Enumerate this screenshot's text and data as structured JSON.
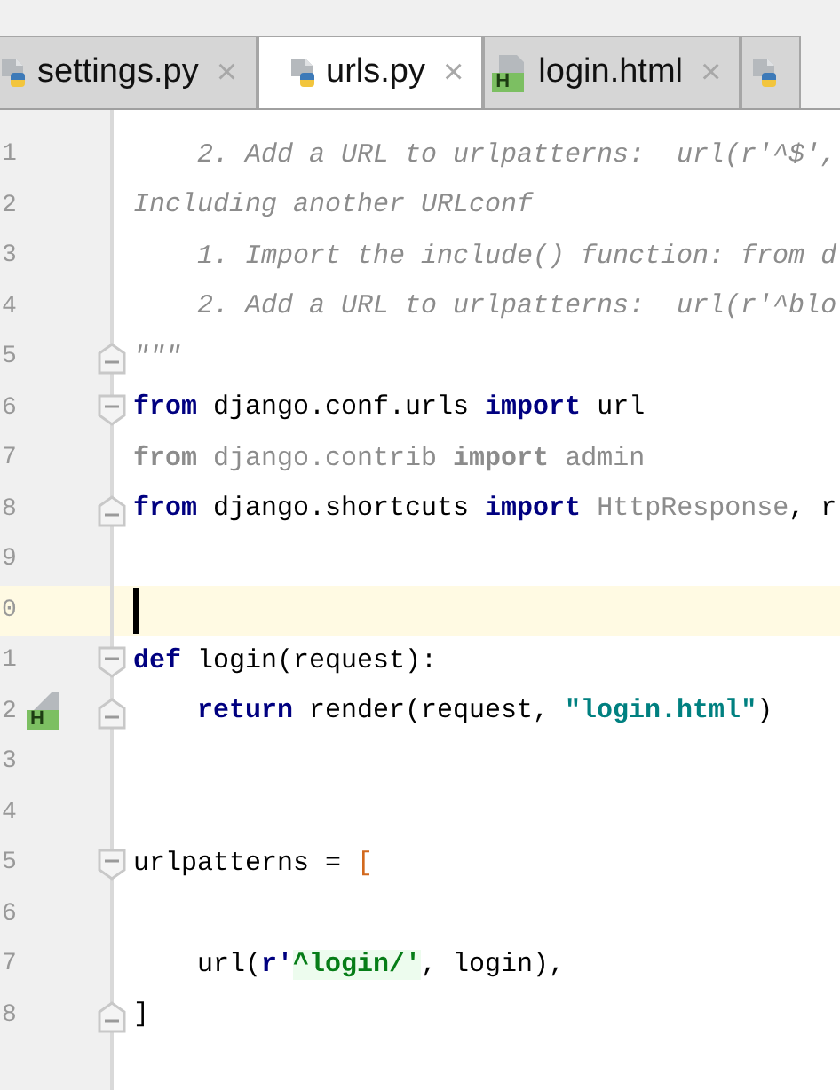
{
  "tabs": [
    {
      "label": "settings.py",
      "kind": "python",
      "close": "×",
      "selected": false
    },
    {
      "label": "urls.py",
      "kind": "python",
      "close": "×",
      "selected": true
    },
    {
      "label": "login.html",
      "kind": "html",
      "badge": "H",
      "close": "×",
      "selected": false
    },
    {
      "kind": "python",
      "selected": false
    }
  ],
  "editor": {
    "lines": [
      {
        "number": "1",
        "tokens": [
          {
            "text": "    2. Add a URL to urlpatterns:  url(r'^$',",
            "kind": "comment"
          }
        ]
      },
      {
        "number": "2",
        "tokens": [
          {
            "text": "Including another URLconf",
            "kind": "comment"
          }
        ]
      },
      {
        "number": "3",
        "tokens": [
          {
            "text": "    1. Import the include() function: from d",
            "kind": "comment"
          }
        ]
      },
      {
        "number": "4",
        "tokens": [
          {
            "text": "    2. Add a URL to urlpatterns:  url(r'^blo",
            "kind": "comment"
          }
        ]
      },
      {
        "number": "5",
        "fold_end": true,
        "tokens": [
          {
            "text": "\"\"\"",
            "kind": "comment"
          }
        ]
      },
      {
        "number": "6",
        "fold_start": true,
        "tokens": [
          {
            "text": "from",
            "kind": "keyword"
          },
          {
            "text": " django.conf.urls ",
            "kind": "plain"
          },
          {
            "text": "import",
            "kind": "keyword"
          },
          {
            "text": " url",
            "kind": "plain"
          }
        ]
      },
      {
        "number": "7",
        "tokens": [
          {
            "text": "from",
            "kind": "unusedkeyword"
          },
          {
            "text": " django.contrib ",
            "kind": "unused"
          },
          {
            "text": "import",
            "kind": "unusedkeyword"
          },
          {
            "text": " admin",
            "kind": "unused"
          }
        ]
      },
      {
        "number": "8",
        "fold_end": true,
        "tokens": [
          {
            "text": "from",
            "kind": "keyword"
          },
          {
            "text": " django.shortcuts ",
            "kind": "plain"
          },
          {
            "text": "import",
            "kind": "keyword"
          },
          {
            "text": " HttpResponse",
            "kind": "unused"
          },
          {
            "text": ", r",
            "kind": "plain"
          }
        ]
      },
      {
        "number": "9"
      },
      {
        "number": "0",
        "current": true
      },
      {
        "number": "1",
        "fold_start": true,
        "tokens": [
          {
            "text": "def",
            "kind": "keyword"
          },
          {
            "text": " login(request):",
            "kind": "plain"
          }
        ]
      },
      {
        "number": "2",
        "fold_end": true,
        "marker": "H",
        "indented": true,
        "tokens": [
          {
            "text": "return",
            "kind": "keyword"
          },
          {
            "text": " render(request, ",
            "kind": "plain"
          },
          {
            "text": "\"login.html\"",
            "kind": "string"
          },
          {
            "text": ")",
            "kind": "plain"
          }
        ]
      },
      {
        "number": "3"
      },
      {
        "number": "4"
      },
      {
        "number": "5",
        "fold_start": true,
        "tokens": [
          {
            "text": "urlpatterns = ",
            "kind": "plain"
          },
          {
            "text": "[",
            "kind": "bracket"
          }
        ]
      },
      {
        "number": "6"
      },
      {
        "number": "7",
        "indented": true,
        "tokens": [
          {
            "text": "url(",
            "kind": "plain"
          },
          {
            "text": "r'",
            "kind": "prefix"
          },
          {
            "text": "^login/'",
            "kind": "regex"
          },
          {
            "text": ", login),",
            "kind": "plain"
          }
        ]
      },
      {
        "number": "8",
        "fold_end": true,
        "tokens": [
          {
            "text": "]",
            "kind": "plain"
          }
        ]
      }
    ]
  }
}
